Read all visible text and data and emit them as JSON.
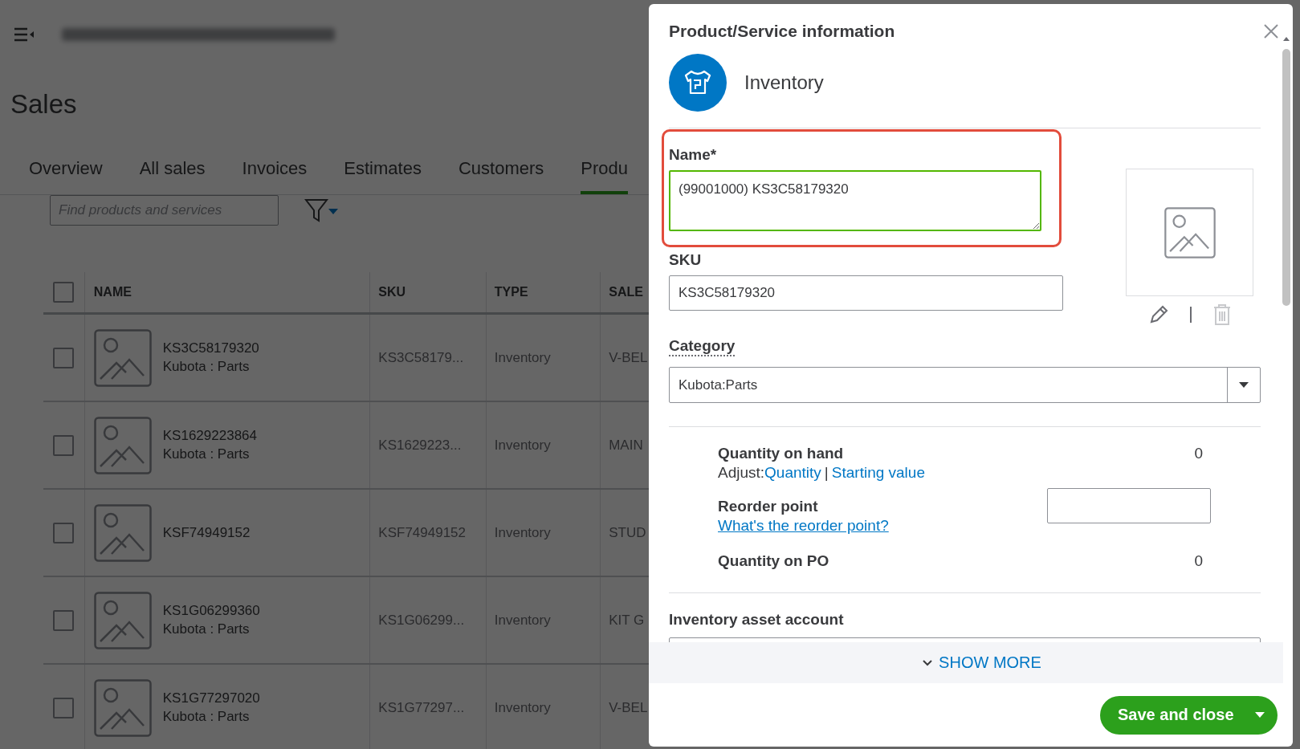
{
  "page": {
    "title": "Sales",
    "tabs": [
      {
        "label": "Overview",
        "selected": false
      },
      {
        "label": "All sales",
        "selected": false
      },
      {
        "label": "Invoices",
        "selected": false
      },
      {
        "label": "Estimates",
        "selected": false
      },
      {
        "label": "Customers",
        "selected": false
      },
      {
        "label": "Produ",
        "selected": true
      }
    ],
    "search": {
      "placeholder": "Find products and services"
    },
    "table": {
      "select_all_checked": false,
      "columns": [
        "NAME",
        "SKU",
        "TYPE",
        "SALE"
      ],
      "rows": [
        {
          "checked": false,
          "name": "KS3C58179320",
          "category": "Kubota : Parts",
          "sku": "KS3C58179...",
          "type": "Inventory",
          "column_4": "V-BEL"
        },
        {
          "checked": false,
          "name": "KS1629223864",
          "category": "Kubota : Parts",
          "sku": "KS1629223...",
          "type": "Inventory",
          "column_4": "MAIN"
        },
        {
          "checked": false,
          "name": "KSF74949152",
          "sku": "KSF74949152",
          "type": "Inventory",
          "column_4": "STUD"
        },
        {
          "checked": false,
          "name": "KS1G06299360",
          "category": "Kubota : Parts",
          "sku": "KS1G06299...",
          "type": "Inventory",
          "column_4": "KIT G"
        },
        {
          "checked": false,
          "name": "KS1G77297020",
          "category": "Kubota : Parts",
          "sku": "KS1G77297...",
          "type": "Inventory",
          "column_4": "V-BEL"
        }
      ]
    }
  },
  "dialog": {
    "title": "Product/Service information",
    "type_label": "Inventory",
    "name": {
      "label": "Name*",
      "value": "(99001000) KS3C58179320",
      "highlighted": true,
      "focused": true
    },
    "sku": {
      "label": "SKU",
      "value": "KS3C58179320"
    },
    "category": {
      "label": "Category",
      "value": "Kubota:Parts"
    },
    "quantity_on_hand": {
      "label": "Quantity on hand",
      "value": "0",
      "adjust_label": "Adjust:",
      "links": [
        "Quantity",
        "Starting value"
      ],
      "separator": "|"
    },
    "reorder_point": {
      "label": "Reorder point",
      "help_link": "What's the reorder point?"
    },
    "quantity_on_po": {
      "label": "Quantity on PO",
      "value": "0"
    },
    "inventory_asset_account": {
      "label": "Inventory asset account"
    },
    "show_more": "SHOW MORE",
    "primary_button": "Save and close"
  }
}
